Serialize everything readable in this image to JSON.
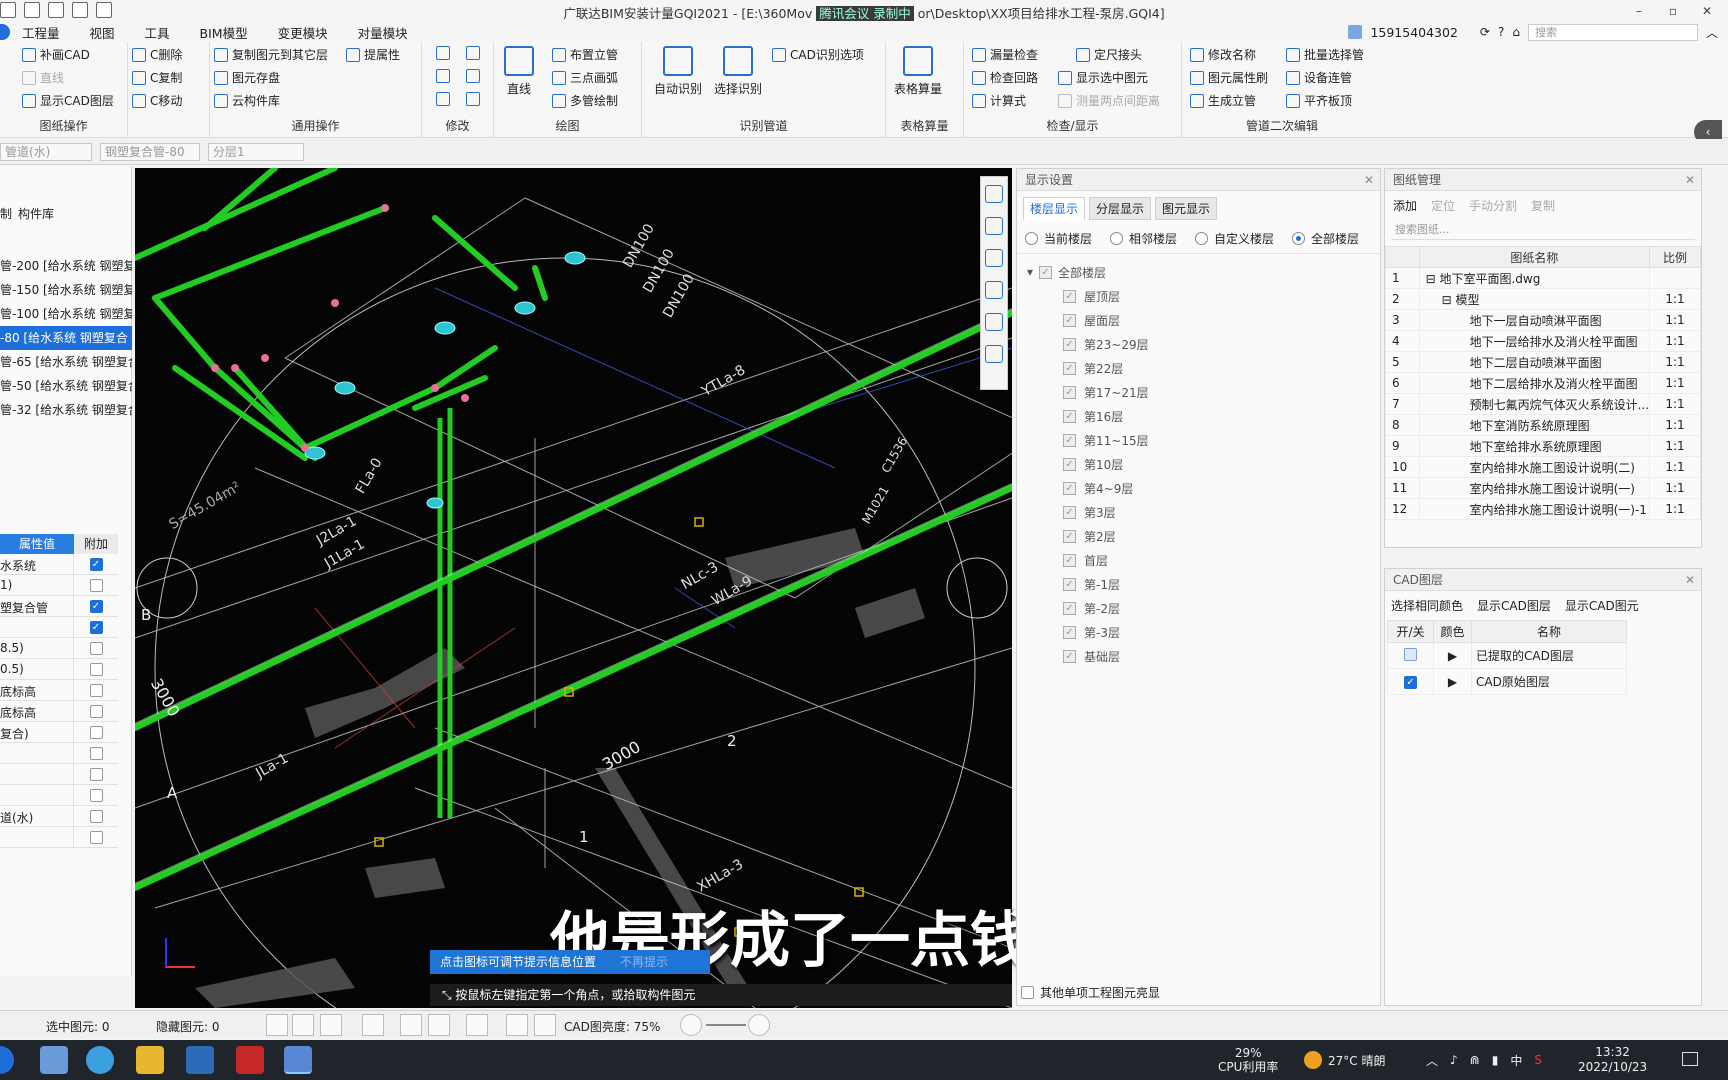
{
  "window": {
    "title": "广联达BIM安装计量GQI2021 - [E:\\360Move\\...\\Desktop\\XX项目给排水工程-泵房.GQI4]",
    "title_visible": "广联达BIM安装计量GQI2021 - [E:\\360Mov",
    "title_tail": "or\\Desktop\\XX项目给排水工程-泵房.GQI4]",
    "title_overlay": "腾讯会议 录制中",
    "controls": [
      "–",
      "▫",
      "✕"
    ]
  },
  "menu": {
    "items": [
      "工程量",
      "视图",
      "工具",
      "BIM模型",
      "变更模块",
      "对量模块"
    ],
    "user": "15915404302",
    "search_placeholder": "搜索"
  },
  "ribbon": {
    "groups": {
      "drawing_ops": {
        "title": "图纸操作",
        "buttons": [
          "补画CAD",
          "C删除",
          "直线",
          "C复制",
          "显示CAD图层",
          "C移动"
        ]
      },
      "common_ops": {
        "title": "通用操作",
        "buttons": [
          "复制图元到其它层",
          "提属性",
          "图元存盘",
          "云构件库"
        ]
      },
      "modify": {
        "title": "修改"
      },
      "draw": {
        "title": "绘图",
        "big": "直线",
        "buttons": [
          "布置立管",
          "三点画弧",
          "多管绘制"
        ]
      },
      "recognize": {
        "title": "识别管道",
        "big1": "自动识别",
        "big2": "选择识别",
        "buttons": [
          "CAD识别选项"
        ]
      },
      "table": {
        "title": "表格算量",
        "big": "表格算量"
      },
      "check": {
        "title": "检查/显示",
        "buttons": [
          "漏量检查",
          "定尺接头",
          "检查回路",
          "显示选中图元",
          "计算式",
          "测量两点间距离"
        ]
      },
      "pipe_edit": {
        "title": "管道二次编辑",
        "buttons": [
          "修改名称",
          "批量选择管",
          "图元属性刷",
          "设备连管",
          "生成立管",
          "平齐板顶"
        ]
      }
    }
  },
  "combos": [
    "管道(水)",
    "钢塑复合管-80",
    "分层1"
  ],
  "left_panel": {
    "tab_partial": "制",
    "tab_lib": "构件库",
    "items": [
      "管-200 [给水系统 钢塑复",
      "管-150 [给水系统 钢塑复",
      "管-100 [给水系统 钢塑复",
      "-80 [给水系统 钢塑复合",
      "管-65 [给水系统 钢塑复合",
      "管-50 [给水系统 钢塑复合",
      "管-32 [给水系统 钢塑复合"
    ],
    "selected_index": 3,
    "prop_header": [
      "属性值",
      "附加"
    ],
    "props": [
      {
        "v": "水系统",
        "c": true
      },
      {
        "v": "1)",
        "c": false
      },
      {
        "v": "塑复合管",
        "c": true
      },
      {
        "v": "",
        "c": true
      },
      {
        "v": "8.5)",
        "c": false
      },
      {
        "v": "0.5)",
        "c": false
      },
      {
        "v": "底标高",
        "c": false
      },
      {
        "v": "底标高",
        "c": false
      },
      {
        "v": "复合)",
        "c": false
      },
      {
        "v": "",
        "c": false
      },
      {
        "v": "",
        "c": false
      },
      {
        "v": "",
        "c": false
      },
      {
        "v": "道(水)",
        "c": false
      },
      {
        "v": "",
        "c": false
      }
    ]
  },
  "canvas": {
    "subtitle": "他是形成了一点钱",
    "tip_blue": "点击图标可调节提示信息位置",
    "tip_blue_faint": "不再提示",
    "tip_dark": "按鼠标左键指定第一个角点，或拾取构件图元",
    "labels": [
      "DN100",
      "DN100",
      "DN100",
      "YTLa-8",
      "FLa-0",
      "J2La-1",
      "J1La-1",
      "S=45.04m²",
      "NLc-3",
      "WLa-9",
      "3000",
      "3000",
      "B",
      "A",
      "1",
      "2",
      "XHLa-3",
      "JLa-1",
      "M1021",
      "C1536"
    ]
  },
  "display_settings": {
    "title": "显示设置",
    "tabs": [
      "楼层显示",
      "分层显示",
      "图元显示"
    ],
    "active_tab": 0,
    "radios": [
      "当前楼层",
      "相邻楼层",
      "自定义楼层",
      "全部楼层"
    ],
    "selected_radio": 3,
    "root": "全部楼层",
    "floors": [
      "屋顶层",
      "屋面层",
      "第23~29层",
      "第22层",
      "第17~21层",
      "第16层",
      "第11~15层",
      "第10层",
      "第4~9层",
      "第3层",
      "第2层",
      "首层",
      "第-1层",
      "第-2层",
      "第-3层",
      "基础层"
    ],
    "bottom_check": "其他单项工程图元亮显"
  },
  "drawing_mgmt": {
    "title": "图纸管理",
    "toolbar": [
      "添加",
      "定位",
      "手动分割",
      "复制"
    ],
    "search_placeholder": "搜索图纸...",
    "columns": [
      "图纸名称",
      "比例"
    ],
    "rows": [
      {
        "n": "1",
        "name": "地下室平面图.dwg",
        "ratio": ""
      },
      {
        "n": "2",
        "name": "模型",
        "ratio": "1:1"
      },
      {
        "n": "3",
        "name": "地下一层自动喷淋平面图",
        "ratio": "1:1"
      },
      {
        "n": "4",
        "name": "地下一层给排水及消火栓平面图",
        "ratio": "1:1"
      },
      {
        "n": "5",
        "name": "地下二层自动喷淋平面图",
        "ratio": "1:1"
      },
      {
        "n": "6",
        "name": "地下二层给排水及消火栓平面图",
        "ratio": "1:1"
      },
      {
        "n": "7",
        "name": "预制七氟丙烷气体灭火系统设计...",
        "ratio": "1:1"
      },
      {
        "n": "8",
        "name": "地下室消防系统原理图",
        "ratio": "1:1"
      },
      {
        "n": "9",
        "name": "地下室给排水系统原理图",
        "ratio": "1:1"
      },
      {
        "n": "10",
        "name": "室内给排水施工图设计说明(二)",
        "ratio": "1:1"
      },
      {
        "n": "11",
        "name": "室内给排水施工图设计说明(一)",
        "ratio": "1:1"
      },
      {
        "n": "12",
        "name": "室内给排水施工图设计说明(一)-1",
        "ratio": "1:1"
      }
    ]
  },
  "cad_layers": {
    "title": "CAD图层",
    "options": [
      "选择相同颜色",
      "显示CAD图层",
      "显示CAD图元"
    ],
    "columns": [
      "开/关",
      "颜色",
      "名称"
    ],
    "rows": [
      {
        "on": false,
        "name": "已提取的CAD图层"
      },
      {
        "on": true,
        "name": "CAD原始图层"
      }
    ]
  },
  "status": {
    "selected": "选中图元: 0",
    "hidden": "隐藏图元: 0",
    "cad_brightness_label": "CAD图亮度: 75%"
  },
  "taskbar": {
    "cpu": "29%",
    "cpu_label": "CPU利用率",
    "weather": "27°C 晴朗",
    "ime": "中",
    "time": "13:32",
    "date": "2022/10/23"
  },
  "colors": {
    "accent": "#1e6fd9",
    "pipe_green": "#22cc22",
    "canvas_bg": "#050505"
  }
}
